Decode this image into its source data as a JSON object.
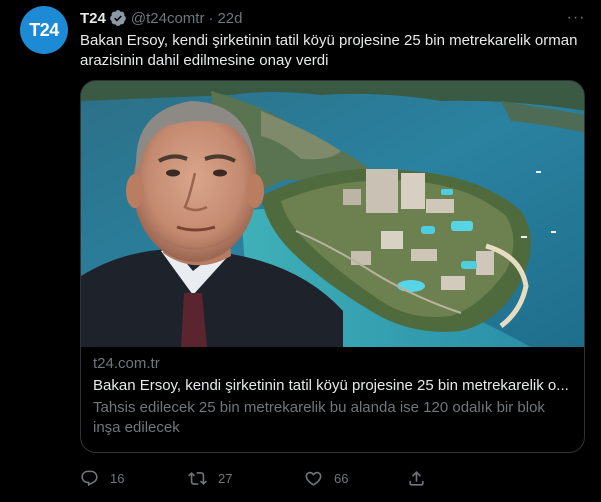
{
  "account": {
    "display_name": "T24",
    "handle": "@t24comtr",
    "separator": "·",
    "time": "22d",
    "avatar_text": "T24",
    "verified": true
  },
  "tweet": {
    "text": "Bakan Ersoy, kendi şirketinin tatil köyü projesine 25 bin metrekarelik orman arazisinin dahil edilmesine onay verdi"
  },
  "card": {
    "domain": "t24.com.tr",
    "title": "Bakan Ersoy, kendi şirketinin tatil köyü projesine 25 bin metrekarelik o...",
    "description": "Tahsis edilecek 25 bin metrekarelik bu alanda ise 120 odalık bir blok inşa edilecek"
  },
  "actions": {
    "replies": "16",
    "retweets": "27",
    "likes": "66",
    "more_label": "···"
  },
  "colors": {
    "background": "#000000",
    "text_primary": "#e7e9ea",
    "text_secondary": "#71767b",
    "border": "#2f3336",
    "avatar_bg": "#1d8ad6",
    "verified": "#8b98a5"
  },
  "icons": {
    "reply": "reply-icon",
    "retweet": "retweet-icon",
    "like": "heart-icon",
    "share": "share-icon",
    "verified": "verified-badge-icon",
    "more": "more-icon"
  }
}
